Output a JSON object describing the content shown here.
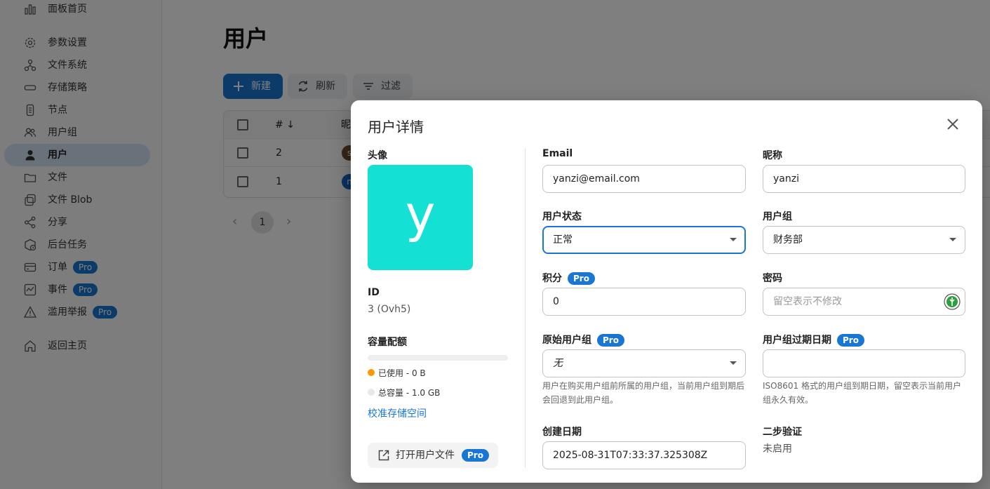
{
  "sidebar": {
    "items": [
      {
        "label": "面板首页",
        "icon": "dashboard-icon",
        "pro": false,
        "active": false
      },
      {
        "label": "参数设置",
        "icon": "settings-icon",
        "pro": false,
        "active": false
      },
      {
        "label": "文件系统",
        "icon": "file-system-icon",
        "pro": false,
        "active": false
      },
      {
        "label": "存储策略",
        "icon": "storage-policy-icon",
        "pro": false,
        "active": false
      },
      {
        "label": "节点",
        "icon": "node-icon",
        "pro": false,
        "active": false
      },
      {
        "label": "用户组",
        "icon": "user-group-icon",
        "pro": false,
        "active": false
      },
      {
        "label": "用户",
        "icon": "user-icon",
        "pro": false,
        "active": true
      },
      {
        "label": "文件",
        "icon": "folder-icon",
        "pro": false,
        "active": false
      },
      {
        "label": "文件 Blob",
        "icon": "blob-icon",
        "pro": false,
        "active": false
      },
      {
        "label": "分享",
        "icon": "share-icon",
        "pro": false,
        "active": false
      },
      {
        "label": "后台任务",
        "icon": "task-icon",
        "pro": false,
        "active": false
      },
      {
        "label": "订单",
        "icon": "order-icon",
        "pro": true,
        "active": false
      },
      {
        "label": "事件",
        "icon": "event-icon",
        "pro": true,
        "active": false
      },
      {
        "label": "滥用举报",
        "icon": "warning-icon",
        "pro": true,
        "active": false
      },
      {
        "label": "返回主页",
        "icon": "home-icon",
        "pro": false,
        "active": false
      }
    ],
    "pro_badge": "Pro"
  },
  "main": {
    "title": "用户",
    "toolbar": {
      "new_label": "新建",
      "refresh_label": "刷新",
      "filter_label": "过滤"
    },
    "table": {
      "headers": {
        "id": "#",
        "nickname": "昵"
      },
      "rows": [
        {
          "id": "2",
          "avatar_letter": "s",
          "avatar_color": "#6d4c2f"
        },
        {
          "id": "1",
          "avatar_letter": "n",
          "avatar_color": "#1565c0"
        }
      ]
    },
    "pagination": {
      "current_page": "1"
    }
  },
  "dialog": {
    "title": "用户详情",
    "avatar": {
      "label": "头像",
      "letter": "y",
      "color": "#15e0d4"
    },
    "id": {
      "label": "ID",
      "value": "3 (Ovh5)"
    },
    "quota": {
      "label": "容量配额",
      "used_fraction": 0,
      "used_text": "已使用 - 0 B",
      "used_color": "#ff9800",
      "total_text": "总容量 - 1.0 GB",
      "total_color": "#e8e8e8",
      "recalc_link": "校准存储空间"
    },
    "open_files": {
      "label": "打开用户文件",
      "pro": "Pro"
    },
    "fields": {
      "email": {
        "label": "Email",
        "value": "yanzi@email.com"
      },
      "nickname": {
        "label": "昵称",
        "value": "yanzi"
      },
      "status": {
        "label": "用户状态",
        "value": "正常"
      },
      "group": {
        "label": "用户组",
        "value": "财务部"
      },
      "points": {
        "label": "积分",
        "pro": "Pro",
        "value": "0"
      },
      "password": {
        "label": "密码",
        "placeholder": "留空表示不修改"
      },
      "original_group": {
        "label": "原始用户组",
        "pro": "Pro",
        "value": "无",
        "helper": "用户在购买用户组前所属的用户组，当前用户组到期后会回退到此用户组。"
      },
      "group_expires": {
        "label": "用户组过期日期",
        "pro": "Pro",
        "value": "",
        "helper": "ISO8601 格式的用户组到期日期，留空表示当前用户组永久有效。"
      },
      "created": {
        "label": "创建日期",
        "value": "2025-08-31T07:33:37.325308Z"
      },
      "two_factor": {
        "label": "二步验证",
        "value": "未启用"
      }
    }
  }
}
